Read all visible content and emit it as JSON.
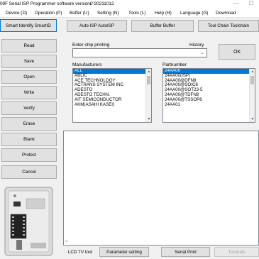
{
  "titlebar": {
    "title": "09F Serial ISP Programmer software version£º20211012",
    "minimize_glyph": "—",
    "close_glyph": "☐"
  },
  "menu": {
    "items": [
      {
        "label": "Device (D)"
      },
      {
        "label": "Operation (P)"
      },
      {
        "label": "Buffer (U)"
      },
      {
        "label": "Setting (N)"
      },
      {
        "label": "Tools (L)"
      },
      {
        "label": "Help (H)"
      },
      {
        "label": "Language (G)"
      },
      {
        "label": "Download"
      }
    ]
  },
  "toolbar": {
    "smart_identify": "Smart Identify SmartID",
    "auto_isp": "Auto ISP AutoISP",
    "buffer": "Buffer Buffer",
    "tool_chain": "Tool Chain Toolchain"
  },
  "sidebar": {
    "buttons": [
      {
        "label": "Read"
      },
      {
        "label": "Save"
      },
      {
        "label": "Open"
      },
      {
        "label": "Write"
      },
      {
        "label": "Verify"
      },
      {
        "label": "Erase"
      },
      {
        "label": "Blank"
      },
      {
        "label": "Protect"
      },
      {
        "label": "Cancel"
      }
    ]
  },
  "chip_search": {
    "label": "Enter chip printing",
    "history_label": "History",
    "value": "",
    "ok_label": "OK"
  },
  "manufacturers": {
    "label": "Manufacturers",
    "items": [
      "ALL",
      "ABLIC",
      "ACE TECHNOLOGY",
      "ACTRANS SYSTEM INC",
      "ADESTO",
      "ADESTO TECHN.",
      "AIT SEMICONDUCTOR",
      "AKM(ASAHI KASEI)"
    ],
    "selected_index": 0
  },
  "partnumbers": {
    "label": "Partnumber",
    "items": [
      "24AA00",
      "24AA00(ISP)",
      "24AA00@DFN8",
      "24AA00@SOIC8",
      "24AA00@SOT23-5",
      "24AA00@TDFN8",
      "24AA00@TSSOP8",
      "24AA01"
    ],
    "selected_index": 0
  },
  "bottom_bar": {
    "lcd_tv_tool": "LCD TV tool",
    "parameter_setting": "Parameter setting",
    "serial_print": "Serial Print",
    "tutorials": "Tutorials"
  },
  "colors": {
    "selection": "#0078d7",
    "button_face": "#e1e1e1",
    "window_bg": "#f0f0f0"
  }
}
